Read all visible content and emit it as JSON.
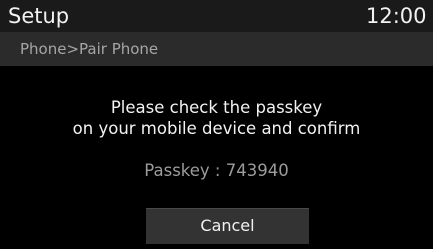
{
  "header": {
    "title": "Setup",
    "clock": "12:00"
  },
  "breadcrumb": "Phone>Pair Phone",
  "dialog": {
    "message_line1": "Please check the passkey",
    "message_line2": "on your mobile device and confirm",
    "passkey_text": "Passkey : 743940",
    "cancel_label": "Cancel"
  },
  "colors": {
    "background": "#000000",
    "header_bg": "#1a1a1a",
    "subheader_bg": "#2b2b2b",
    "button_bg": "#333333",
    "text_primary": "#f2f2f2",
    "text_secondary": "#9c9c9c"
  }
}
